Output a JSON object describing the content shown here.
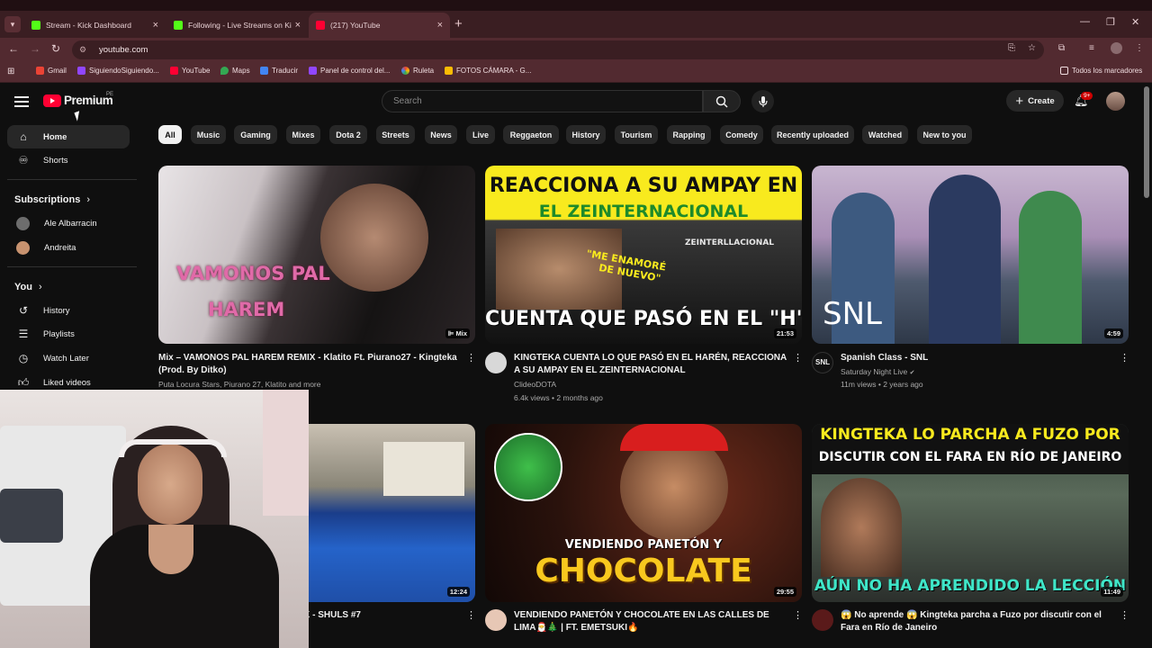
{
  "browser": {
    "tabs": [
      {
        "title": "Stream - Kick Dashboard",
        "favicon_color": "#53fc18"
      },
      {
        "title": "Following - Live Streams on Kic",
        "favicon_color": "#53fc18"
      },
      {
        "title": "(217) YouTube",
        "favicon_color": "#ff0033"
      }
    ],
    "url": "youtube.com",
    "bookmarks": [
      "Gmail",
      "SiguiendoSiguiendo...",
      "YouTube",
      "Maps",
      "Traducir",
      "Panel de control del...",
      "Ruleta",
      "FOTOS CÁMARA - G..."
    ],
    "all_bookmarks": "Todos los marcadores"
  },
  "header": {
    "logo": "Premium",
    "region": "PE",
    "search_placeholder": "Search",
    "create_label": "Create",
    "notifications_badge": "9+"
  },
  "sidebar": {
    "main": [
      {
        "label": "Home",
        "icon": "home-icon"
      },
      {
        "label": "Shorts",
        "icon": "shorts-icon"
      }
    ],
    "subscriptions_heading": "Subscriptions",
    "subscriptions": [
      "Ale Albarracin",
      "Andreita"
    ],
    "you_heading": "You",
    "you_items": [
      {
        "label": "History",
        "icon": "history-icon"
      },
      {
        "label": "Playlists",
        "icon": "playlists-icon"
      },
      {
        "label": "Watch Later",
        "icon": "watch-later-icon"
      },
      {
        "label": "Liked videos",
        "icon": "thumbs-up-icon"
      }
    ]
  },
  "chips": [
    "All",
    "Music",
    "Gaming",
    "Mixes",
    "Dota 2",
    "Streets",
    "News",
    "Live",
    "Reggaeton",
    "History",
    "Tourism",
    "Rapping",
    "Comedy",
    "Recently uploaded",
    "Watched",
    "New to you"
  ],
  "videos": [
    {
      "title": "Mix – VAMONOS PAL HAREM REMIX - Klatito Ft. Piurano27 - Kingteka (Prod. By Ditko)",
      "channel": "Puta Locura Stars, Piurano 27, Klatito and more",
      "stats": "",
      "badge": "Mix",
      "thumb_text": [
        "VAMONOS PAL",
        "HAREM"
      ]
    },
    {
      "title": "KINGTEKA CUENTA LO QUE PASÓ EN EL HARÉN, REACCIONA A SU AMPAY EN EL ZEINTERNACIONAL",
      "channel": "ClideoDOTA",
      "stats": "6.4k views • 2 months ago",
      "badge": "21:53",
      "thumb_text": [
        "REACCIONA A SU AMPAY EN",
        "EL ZEINTERNACIONAL",
        "\"ME ENAMORÉ",
        "DE NUEVO\"",
        "CUENTA QUE PASÓ EN EL \"H\"",
        "ZEINTERLLACIONAL"
      ]
    },
    {
      "title": "Spanish Class - SNL",
      "channel": "Saturday Night Live",
      "stats": "11m views • 2 years ago",
      "badge": "4:59",
      "thumb_text": [
        "SNL"
      ]
    },
    {
      "title": "K - SHULS #7",
      "channel": "",
      "stats": "",
      "badge": "12:24",
      "thumb_text": []
    },
    {
      "title": "VENDIENDO PANETÓN Y CHOCOLATE EN LAS CALLES DE LIMA🎅🎄 | FT. EMETSUKI🔥",
      "channel": "",
      "stats": "",
      "badge": "29:55",
      "thumb_text": [
        "VENDIENDO PANETÓN Y",
        "CHOCOLATE"
      ]
    },
    {
      "title": "😱 No aprende 😱 Kingteka parcha a Fuzo por discutir con el Fara en Río de Janeiro",
      "channel": "",
      "stats": "",
      "badge": "11:49",
      "thumb_text": [
        "KINGTEKA LO PARCHA A FUZO POR",
        "DISCUTIR CON EL FARA EN RÍO DE JANEIRO",
        "AÚN NO HA APRENDIDO LA LECCIÓN"
      ]
    }
  ],
  "colors": {
    "accent": "#ff0033",
    "bg": "#0f0f0f",
    "chip": "#272727",
    "browser_frame": "#522a30"
  }
}
